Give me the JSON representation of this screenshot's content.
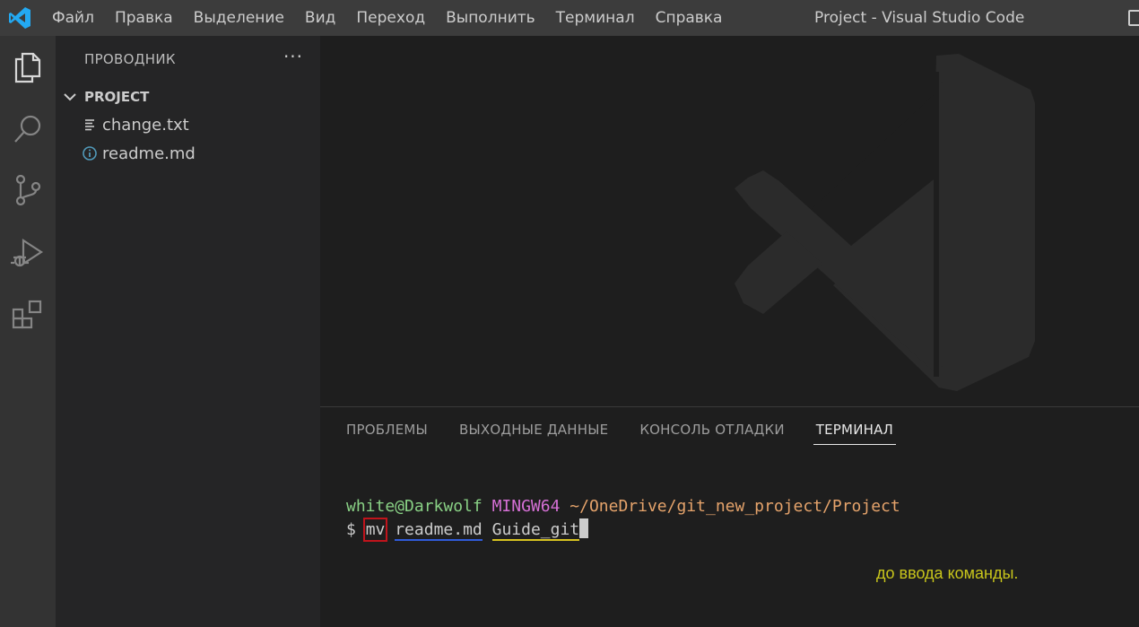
{
  "menu": {
    "items": [
      "Файл",
      "Правка",
      "Выделение",
      "Вид",
      "Переход",
      "Выполнить",
      "Терминал",
      "Справка"
    ]
  },
  "window": {
    "title": "Project - Visual Studio Code"
  },
  "activity_bar": {
    "icons": [
      "explorer-icon",
      "search-icon",
      "source-control-icon",
      "run-debug-icon",
      "extensions-icon"
    ]
  },
  "sidebar": {
    "title": "ПРОВОДНИК",
    "more": "···",
    "section": "PROJECT",
    "files": [
      {
        "name": "change.txt",
        "icon": "text-file-icon"
      },
      {
        "name": "readme.md",
        "icon": "info-file-icon"
      }
    ]
  },
  "panel": {
    "tabs": [
      "ПРОБЛЕМЫ",
      "ВЫХОДНЫЕ ДАННЫЕ",
      "КОНСОЛЬ ОТЛАДКИ",
      "ТЕРМИНАЛ"
    ],
    "active_tab": "ТЕРМИНАЛ"
  },
  "terminal": {
    "user_host": "white@Darkwolf",
    "system": "MINGW64",
    "path": "~/OneDrive/git_new_project/Project",
    "prompt": "$",
    "command": "mv",
    "arg1": "readme.md",
    "arg2": "Guide_git"
  },
  "annotation": "до ввода команды.",
  "colors": {
    "user_host": "#89d185",
    "system": "#d670d6",
    "path": "#e5a36b",
    "command_box": "#c0141c",
    "arg1_underline": "#2f5bd8",
    "arg2_underline": "#d6c220",
    "annotation": "#c8c51b",
    "accent": "#0078d4"
  }
}
